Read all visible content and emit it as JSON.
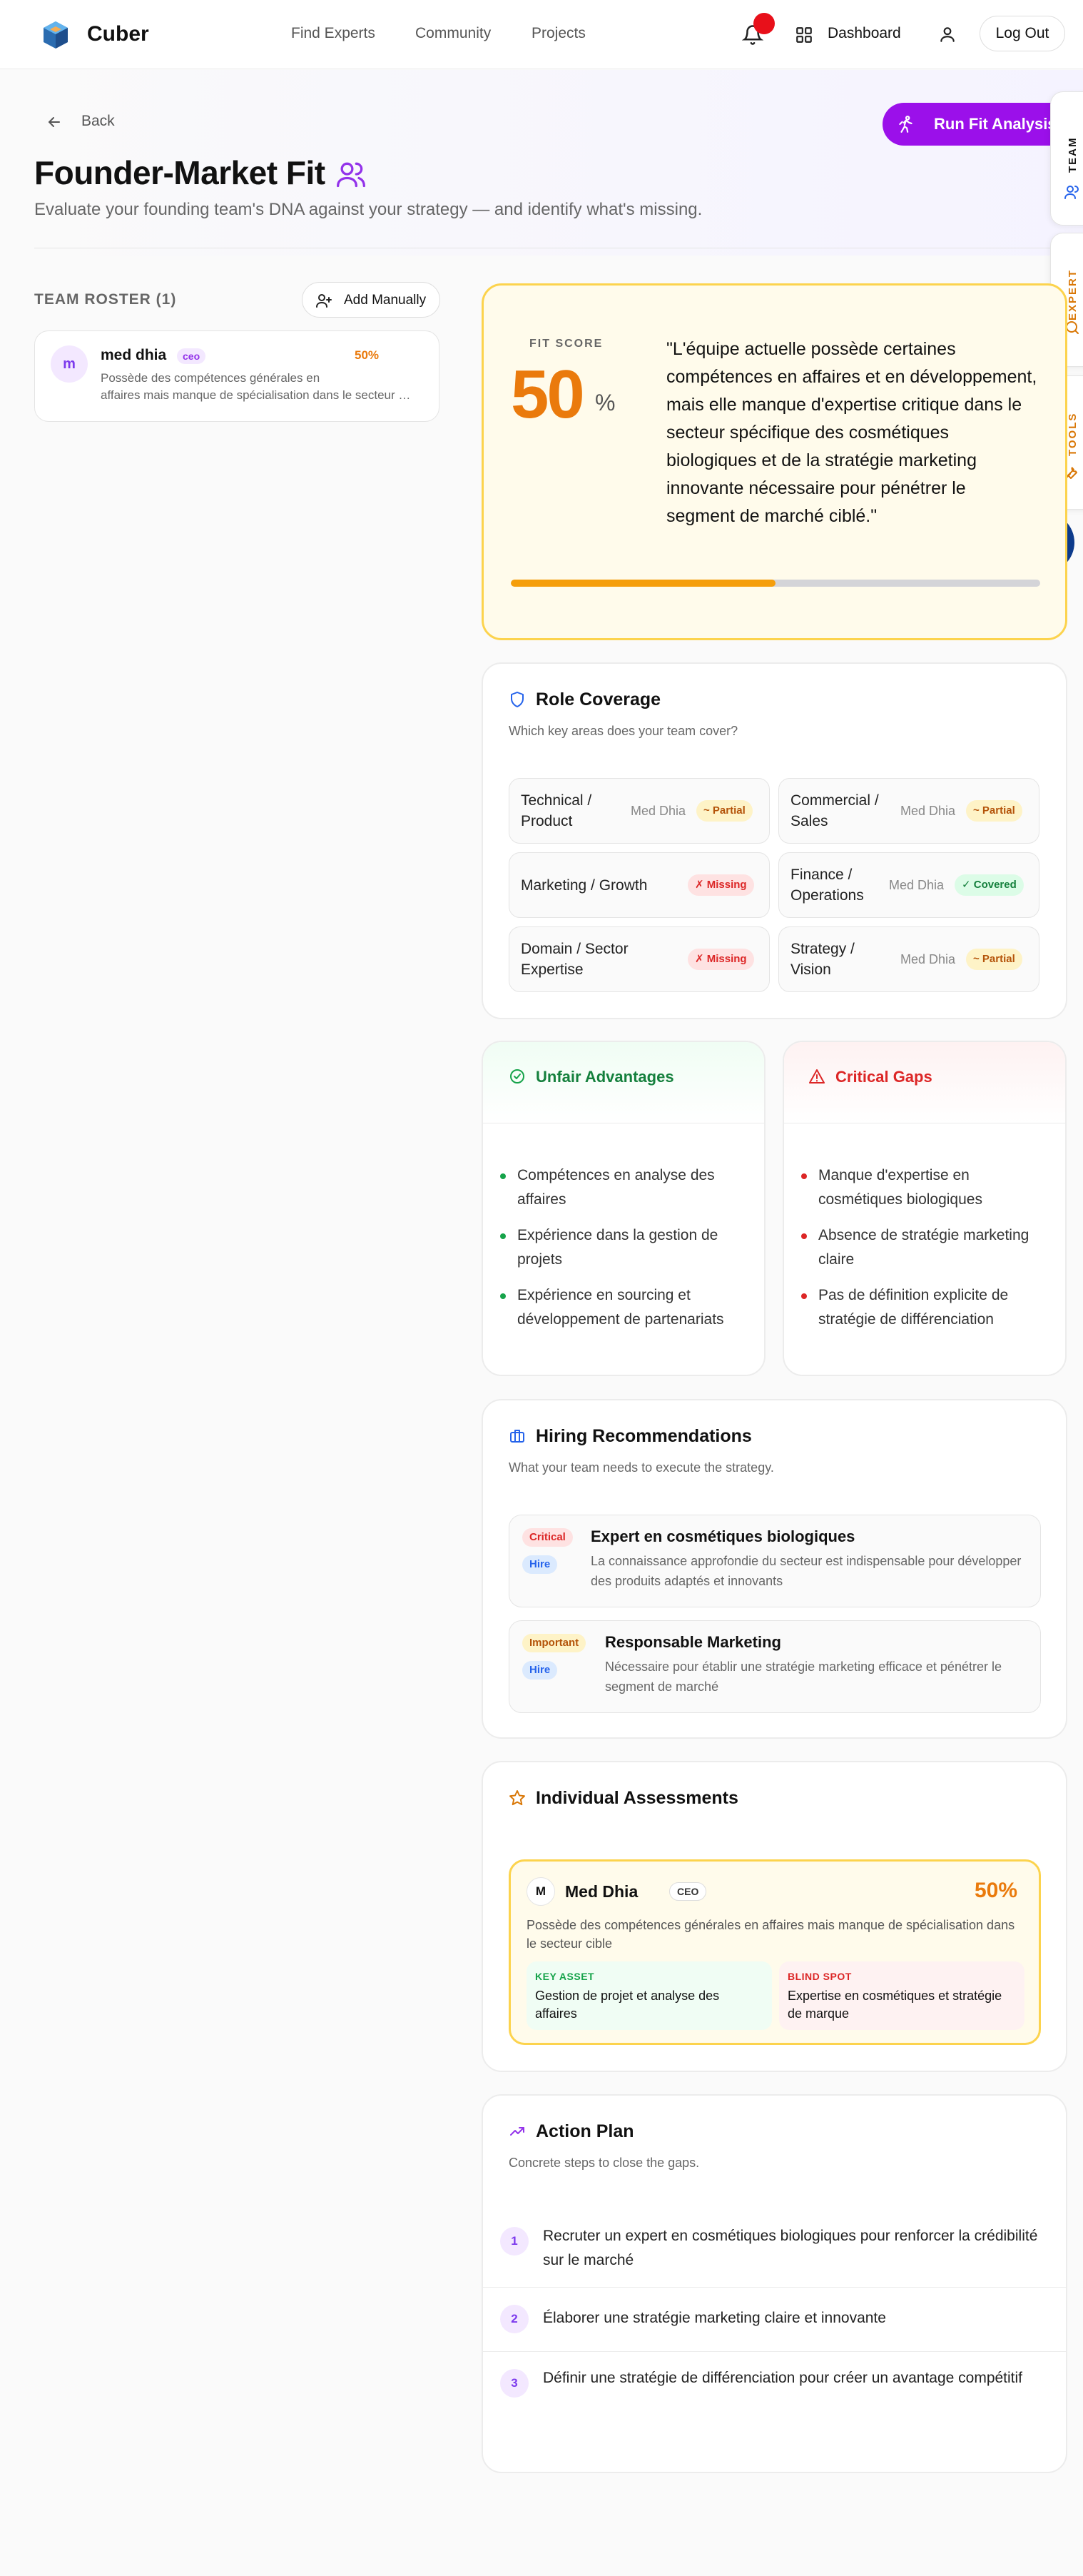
{
  "header": {
    "brand": "Cuber",
    "nav": [
      "Find Experts",
      "Community",
      "Projects"
    ],
    "dashboard_label": "Dashboard",
    "logout_label": "Log Out"
  },
  "hero": {
    "back_label": "Back",
    "run_label": "Run Fit Analysis",
    "title": "Founder-Market Fit",
    "subtitle": "Evaluate your founding team's DNA against your strategy — and identify what's missing."
  },
  "side_tabs": [
    "TEAM",
    "EXPERT",
    "TOOLS"
  ],
  "roster": {
    "title": "TEAM ROSTER (1)",
    "add_label": "Add Manually",
    "members": [
      {
        "initial": "m",
        "name": "med dhia",
        "role": "ceo",
        "score": "50%",
        "desc_line1": "Possède des compétences générales en",
        "desc_line2": "affaires mais manque de spécialisation dans le secteur cible"
      }
    ]
  },
  "fit": {
    "label": "FIT SCORE",
    "score": "50",
    "score_unit": "%",
    "progress": 0.5,
    "quote": "\"L'équipe actuelle possède certaines compétences en affaires et en développement, mais elle manque d'expertise critique dans le secteur spécifique des cosmétiques biologiques et de la stratégie marketing innovante nécessaire pour pénétrer le segment de marché ciblé.\""
  },
  "role_coverage": {
    "title": "Role Coverage",
    "subtitle": "Which key areas does your team cover?",
    "items": [
      {
        "name": "Technical / Product",
        "owner": "Med Dhia",
        "status": "~ Partial"
      },
      {
        "name": "Commercial / Sales",
        "owner": "Med Dhia",
        "status": "~ Partial"
      },
      {
        "name": "Marketing / Growth",
        "owner": "",
        "status": "✗ Missing"
      },
      {
        "name": "Finance / Operations",
        "owner": "Med Dhia",
        "status": "✓ Covered"
      },
      {
        "name": "Domain / Sector Expertise",
        "owner": "",
        "status": "✗ Missing"
      },
      {
        "name": "Strategy / Vision",
        "owner": "Med Dhia",
        "status": "~ Partial"
      }
    ]
  },
  "advantages": {
    "title": "Unfair Advantages",
    "items": [
      "Compétences en analyse des affaires",
      "Expérience dans la gestion de projets",
      "Expérience en sourcing et développement de partenariats"
    ]
  },
  "gaps": {
    "title": "Critical Gaps",
    "items": [
      "Manque d'expertise en cosmétiques biologiques",
      "Absence de stratégie marketing claire",
      "Pas de définition explicite de stratégie de différenciation"
    ]
  },
  "hiring": {
    "title": "Hiring Recommendations",
    "subtitle": "What your team needs to execute the strategy.",
    "items": [
      {
        "priority": "Critical",
        "type": "Hire",
        "title": "Expert en cosmétiques biologiques",
        "desc": "La connaissance approfondie du secteur est indispensable pour développer des produits adaptés et innovants"
      },
      {
        "priority": "Important",
        "type": "Hire",
        "title": "Responsable Marketing",
        "desc": "Nécessaire pour établir une stratégie marketing efficace et pénétrer le segment de marché"
      }
    ]
  },
  "individual": {
    "title": "Individual Assessments",
    "person": {
      "initial": "M",
      "name": "Med Dhia",
      "role": "CEO",
      "score": "50%",
      "desc": "Possède des compétences générales en affaires mais manque de spécialisation dans le secteur cible",
      "key_asset_label": "KEY ASSET",
      "key_asset": "Gestion de projet et analyse des affaires",
      "blind_spot_label": "BLIND SPOT",
      "blind_spot": "Expertise en cosmétiques et stratégie de marque"
    }
  },
  "action_plan": {
    "title": "Action Plan",
    "subtitle": "Concrete steps to close the gaps.",
    "steps": [
      {
        "num": "1",
        "text": "Recruter un expert en cosmétiques biologiques pour renforcer la crédibilité sur le marché"
      },
      {
        "num": "2",
        "text": "Élaborer une stratégie marketing claire et innovante"
      },
      {
        "num": "3",
        "text": "Définir une stratégie de différenciation pour créer un avantage compétitif"
      }
    ]
  },
  "colors": {
    "accent": "#9b10ea",
    "score": "#ea7a0c",
    "covered": "#15803d",
    "missing": "#dc2626",
    "partial": "#b45309"
  }
}
